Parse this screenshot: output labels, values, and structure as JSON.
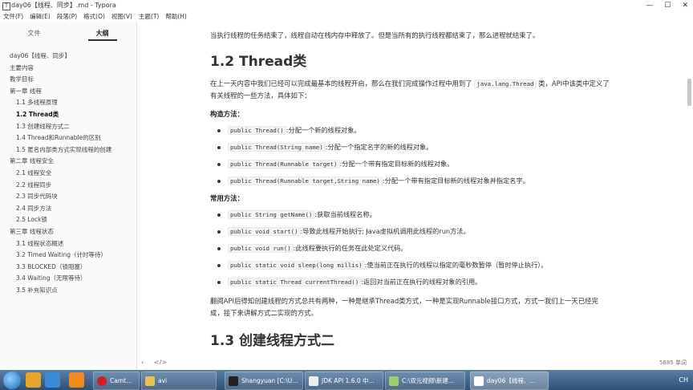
{
  "window": {
    "title": "day06【线程、同步】.md - Typora",
    "min": "—",
    "max": "☐",
    "close": "✕"
  },
  "menu": [
    "文件(F)",
    "编辑(E)",
    "段落(P)",
    "格式(O)",
    "视图(V)",
    "主题(T)",
    "帮助(H)"
  ],
  "sidebar": {
    "tabs": [
      "文件",
      "大纲"
    ],
    "outline": [
      {
        "label": "day06【线程、同步】",
        "level": 1
      },
      {
        "label": "主要内容",
        "level": 2
      },
      {
        "label": "教学目标",
        "level": 2
      },
      {
        "label": "第一章 线程",
        "level": 2
      },
      {
        "label": "1.1 多线程原理",
        "level": 3
      },
      {
        "label": "1.2 Thread类",
        "level": 3,
        "active": true
      },
      {
        "label": "1.3 创建线程方式二",
        "level": 3
      },
      {
        "label": "1.4 Thread和Runnable的区别",
        "level": 3
      },
      {
        "label": "1.5 匿名内部类方式实现线程的创建",
        "level": 3
      },
      {
        "label": "第二章 线程安全",
        "level": 2
      },
      {
        "label": "2.1 线程安全",
        "level": 3
      },
      {
        "label": "2.2 线程同步",
        "level": 3
      },
      {
        "label": "2.3 同步代码块",
        "level": 3
      },
      {
        "label": "2.4 同步方法",
        "level": 3
      },
      {
        "label": "2.5 Lock锁",
        "level": 3
      },
      {
        "label": "第三章 线程状态",
        "level": 2
      },
      {
        "label": "3.1 线程状态概述",
        "level": 3
      },
      {
        "label": "3.2 Timed Waiting（计时等待）",
        "level": 3
      },
      {
        "label": "3.3 BLOCKED（锁阻塞）",
        "level": 3
      },
      {
        "label": "3.4 Waiting（无限等待）",
        "level": 3
      },
      {
        "label": "3.5 补充知识点",
        "level": 3
      }
    ]
  },
  "doc": {
    "top_para": "当执行线程的任务结束了，线程自动在栈内存中释放了。但是当所有的执行线程都结束了，那么进程就结束了。",
    "h2": "1.2 Thread类",
    "intro_pre": "在上一天内容中我们已经可以完成最基本的线程开启，那么在我们完成操作过程中用到了",
    "intro_code": "java.lang.Thread",
    "intro_post": "类，API中该类中定义了有关线程的一些方法，具体如下：",
    "constructors_title": "构造方法：",
    "constructors": [
      {
        "code": "public Thread()",
        "desc": ":分配一个新的线程对象。"
      },
      {
        "code": "public Thread(String name)",
        "desc": ":分配一个指定名字的新的线程对象。"
      },
      {
        "code": "public Thread(Runnable target)",
        "desc": ":分配一个带有指定目标新的线程对象。"
      },
      {
        "code": "public Thread(Runnable target,String name)",
        "desc": ":分配一个带有指定目标新的线程对象并指定名字。"
      }
    ],
    "methods_title": "常用方法：",
    "methods": [
      {
        "code": "public String getName()",
        "desc": ":获取当前线程名称。"
      },
      {
        "code": "public void start()",
        "desc": ":导致此线程开始执行; Java虚拟机调用此线程的run方法。"
      },
      {
        "code": "public void run()",
        "desc": ":此线程要执行的任务在此处定义代码。"
      },
      {
        "code": "public static void sleep(long millis)",
        "desc": ":使当前正在执行的线程以指定的毫秒数暂停（暂时停止执行）。"
      },
      {
        "code": "public static Thread currentThread()",
        "desc": ":返回对当前正在执行的线程对象的引用。"
      }
    ],
    "summary": "翻阅API后得知创建线程的方式总共有两种，一种是继承Thread类方式，一种是实现Runnable接口方式，方式一我们上一天已经完成，接下来讲解方式二实现的方式。",
    "next_h2": "1.3 创建线程方式二"
  },
  "status": {
    "back": "‹",
    "source": "</>",
    "word_count": "5885 单词"
  },
  "taskbar": {
    "buttons": [
      "Camt...",
      "avi",
      "Shangyuan [C:\\U...",
      "JDK API 1.6.0 中...",
      "C:\\双元视频\\新建...",
      "day06【线程、..."
    ],
    "tray": "CH"
  },
  "colors": {
    "taskbar": "#3b5f8a",
    "code_bg": "#f3f4f4",
    "sidebar_bg": "#fafafa"
  }
}
